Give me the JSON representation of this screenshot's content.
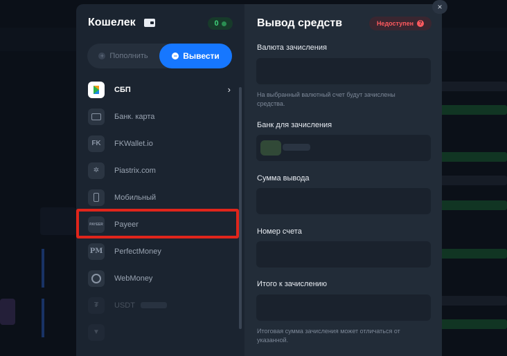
{
  "wallet": {
    "title": "Кошелек",
    "balance": "0",
    "tabs": {
      "deposit_label": "Пополнить",
      "deposit_icon": "+",
      "withdraw_label": "Вывести",
      "withdraw_icon": "−",
      "active": "withdraw"
    },
    "methods": [
      {
        "label": "СБП",
        "icon": "sbp-logo-icon",
        "active": true
      },
      {
        "label": "Банк. карта",
        "icon": "bank-card-icon",
        "active": false
      },
      {
        "label": "FKWallet.io",
        "icon": "fkwallet-logo-icon",
        "icon_text": "FK",
        "active": false
      },
      {
        "label": "Piastrix.com",
        "icon": "piastrix-logo-icon",
        "icon_text": "✲",
        "active": false
      },
      {
        "label": "Мобильный",
        "icon": "mobile-phone-icon",
        "active": false
      },
      {
        "label": "Payeer",
        "icon": "payeer-logo-icon",
        "icon_text": "PAYEER",
        "active": false
      },
      {
        "label": "PerfectMoney",
        "icon": "perfectmoney-logo-icon",
        "icon_text": "PM",
        "active": false
      },
      {
        "label": "WebMoney",
        "icon": "webmoney-logo-icon",
        "active": false
      },
      {
        "label": "USDT",
        "icon": "usdt-logo-icon",
        "icon_text": "₮",
        "active": false
      },
      {
        "label": "",
        "icon": "tron-logo-icon",
        "icon_text": "▼",
        "active": false
      }
    ],
    "chevron": "›"
  },
  "withdraw": {
    "title": "Вывод средств",
    "status": "Недоступен",
    "status_icon": "?",
    "fields": {
      "currency_label": "Валюта зачисления",
      "currency_note": "На выбранный валютный счет будут зачислены средства.",
      "bank_label": "Банк для зачисления",
      "amount_label": "Сумма вывода",
      "account_label": "Номер счета",
      "total_label": "Итого к зачислению",
      "total_note": "Итоговая сумма зачисления может отличаться от указанной."
    }
  },
  "close_icon": "×",
  "colors": {
    "accent": "#1677ff",
    "highlight": "#e0251b",
    "unavailable": "#ff5a5f",
    "balance": "#3fd07a"
  }
}
